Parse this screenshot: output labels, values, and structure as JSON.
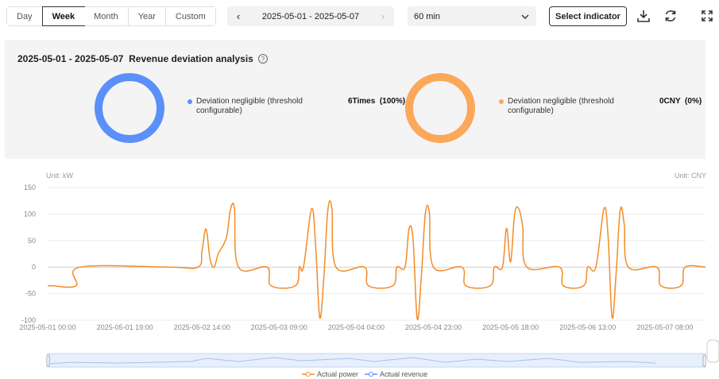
{
  "toolbar": {
    "period_tabs": [
      {
        "label": "Day",
        "active": false
      },
      {
        "label": "Week",
        "active": true
      },
      {
        "label": "Month",
        "active": false
      },
      {
        "label": "Year",
        "active": false
      },
      {
        "label": "Custom",
        "active": false
      }
    ],
    "date_range": "2025-05-01 - 2025-05-07",
    "interval": "60 min",
    "select_indicator_label": "Select indicator",
    "icons": [
      "download-icon",
      "refresh-icon",
      "fullscreen-icon"
    ]
  },
  "analysis": {
    "title": "2025-05-01 - 2025-05-07  Revenue deviation analysis",
    "left": {
      "color": "#5b8ff9",
      "label": "Deviation negligible (threshold configurable)",
      "value": "6Times  (100%)"
    },
    "right": {
      "color": "#fba85a",
      "label": "Deviation negligible (threshold configurable)",
      "value": "0CNY  (0%)"
    }
  },
  "chart": {
    "unit_left": "Unit: kW",
    "unit_right": "Unit: CNY",
    "legend": [
      {
        "name": "Actual power",
        "color": "#f28c28"
      },
      {
        "name": "Actual revenue",
        "color": "#5b8ff9"
      }
    ]
  },
  "chart_data": {
    "type": "line",
    "ylim": [
      -100,
      150
    ],
    "y_ticks": [
      "150",
      "100",
      "50",
      "0",
      "-50",
      "-100"
    ],
    "x_ticks": [
      "2025-05-01 00:00",
      "2025-05-01 19:00",
      "2025-05-02 14:00",
      "2025-05-03 09:00",
      "2025-05-04 04:00",
      "2025-05-04 23:00",
      "2025-05-05 18:00",
      "2025-05-06 13:00",
      "2025-05-07 08:00"
    ],
    "series": [
      {
        "name": "Actual power",
        "color": "#f28c28",
        "points": [
          [
            0,
            -35
          ],
          [
            1,
            -35
          ],
          [
            7,
            -35
          ],
          [
            8,
            0
          ],
          [
            30,
            0
          ],
          [
            37,
            0
          ],
          [
            38,
            30
          ],
          [
            39,
            72
          ],
          [
            40,
            15
          ],
          [
            41,
            0
          ],
          [
            42,
            25
          ],
          [
            44,
            55
          ],
          [
            45,
            108
          ],
          [
            46,
            110
          ],
          [
            47,
            0
          ],
          [
            54,
            0
          ],
          [
            55,
            -35
          ],
          [
            61,
            -35
          ],
          [
            62,
            0
          ],
          [
            63,
            0
          ],
          [
            65,
            110
          ],
          [
            66,
            40
          ],
          [
            67,
            -95
          ],
          [
            68,
            -20
          ],
          [
            69,
            108
          ],
          [
            70,
            110
          ],
          [
            71,
            0
          ],
          [
            78,
            0
          ],
          [
            79,
            -35
          ],
          [
            85,
            -35
          ],
          [
            86,
            0
          ],
          [
            88,
            0
          ],
          [
            89,
            73
          ],
          [
            90,
            50
          ],
          [
            91,
            -97
          ],
          [
            92,
            -20
          ],
          [
            93,
            100
          ],
          [
            94,
            103
          ],
          [
            95,
            0
          ],
          [
            102,
            0
          ],
          [
            103,
            -35
          ],
          [
            109,
            -35
          ],
          [
            110,
            0
          ],
          [
            112,
            0
          ],
          [
            113,
            73
          ],
          [
            114,
            10
          ],
          [
            115,
            100
          ],
          [
            116,
            110
          ],
          [
            117,
            75
          ],
          [
            118,
            0
          ],
          [
            126,
            0
          ],
          [
            127,
            -35
          ],
          [
            132,
            -35
          ],
          [
            133,
            0
          ],
          [
            135,
            0
          ],
          [
            137,
            110
          ],
          [
            138,
            60
          ],
          [
            139,
            -95
          ],
          [
            140,
            -10
          ],
          [
            141,
            108
          ],
          [
            142,
            80
          ],
          [
            143,
            0
          ],
          [
            150,
            0
          ],
          [
            151,
            -35
          ],
          [
            156,
            -35
          ],
          [
            157,
            0
          ],
          [
            162,
            0
          ]
        ]
      }
    ]
  }
}
